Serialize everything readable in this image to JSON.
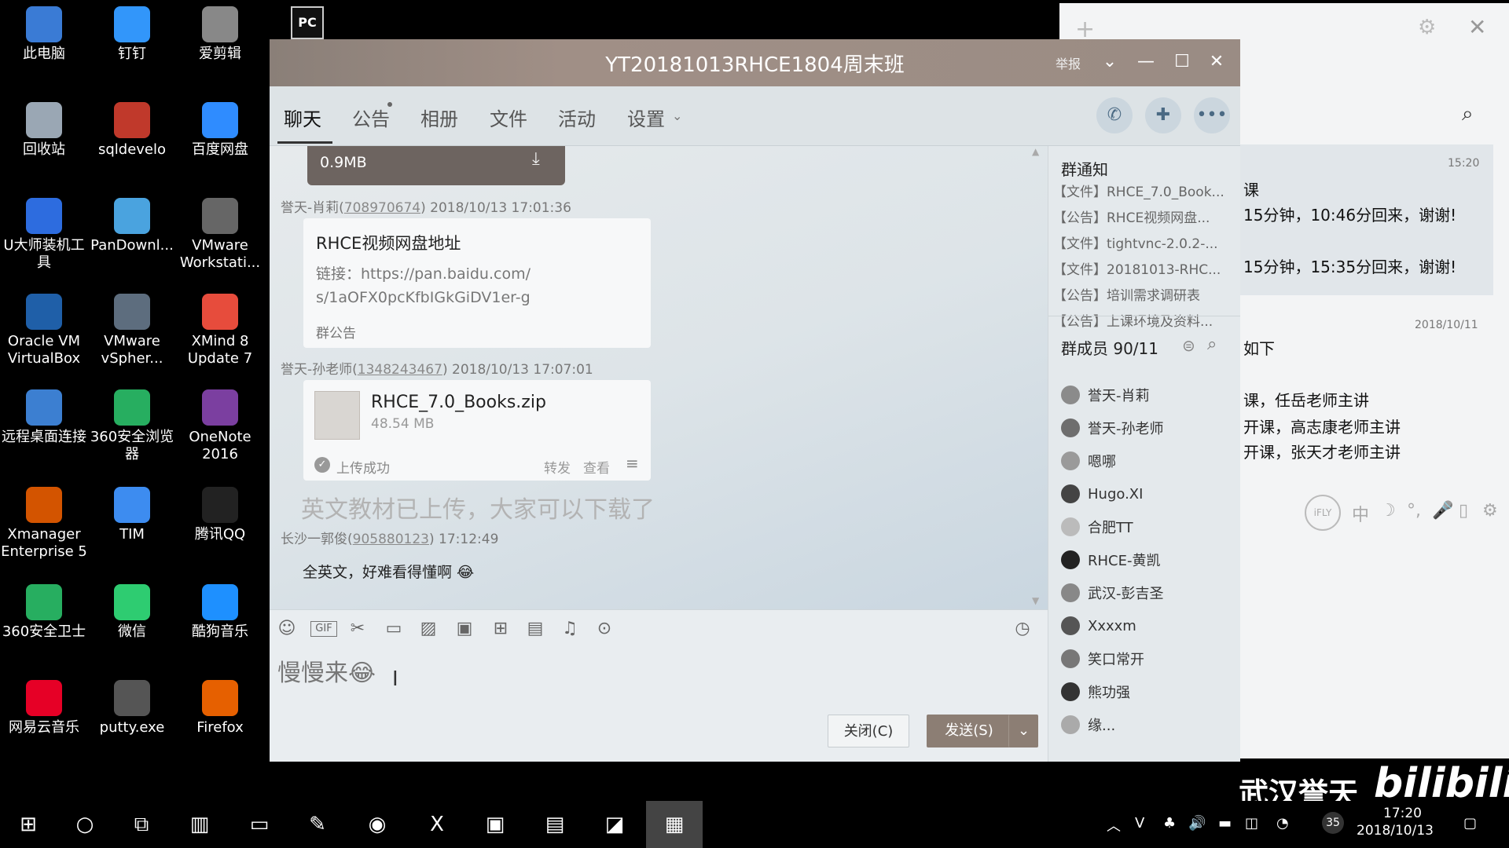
{
  "desktop_icons": [
    {
      "label": "此电脑",
      "icon": "computer-icon",
      "color": "#3a7bd5"
    },
    {
      "label": "钉钉",
      "icon": "dingtalk-icon",
      "color": "#3296fa"
    },
    {
      "label": "爱剪辑",
      "icon": "video-editor-icon",
      "color": "#888888"
    },
    {
      "label": "回收站",
      "icon": "recycle-bin-icon",
      "color": "#9aa7b4"
    },
    {
      "label": "sqldevelo",
      "icon": "sqldeveloper-icon",
      "color": "#c0392b"
    },
    {
      "label": "百度网盘",
      "icon": "baidu-netdisk-icon",
      "color": "#2f8cff"
    },
    {
      "label": "U大师装机工\n具",
      "icon": "usb-tool-icon",
      "color": "#2d6cdf"
    },
    {
      "label": "PanDownl...",
      "icon": "cloud-icon",
      "color": "#4aa3df"
    },
    {
      "label": "VMware\nWorkstati...",
      "icon": "vmware-icon",
      "color": "#666666"
    },
    {
      "label": "Oracle VM\nVirtualBox",
      "icon": "virtualbox-icon",
      "color": "#1f5fa8"
    },
    {
      "label": "VMware\nvSpher...",
      "icon": "vsphere-icon",
      "color": "#5d6d7e"
    },
    {
      "label": "XMind 8\nUpdate 7",
      "icon": "xmind-icon",
      "color": "#e74c3c"
    },
    {
      "label": "远程桌面连接",
      "icon": "remote-desktop-icon",
      "color": "#3c7fd1"
    },
    {
      "label": "360安全浏览\n器",
      "icon": "browser-icon",
      "color": "#27ae60"
    },
    {
      "label": "OneNote\n2016",
      "icon": "onenote-icon",
      "color": "#7b3fa0"
    },
    {
      "label": "Xmanager\nEnterprise 5",
      "icon": "xmanager-icon",
      "color": "#d35400"
    },
    {
      "label": "TIM",
      "icon": "tim-icon",
      "color": "#3d8cf0"
    },
    {
      "label": "腾讯QQ",
      "icon": "qq-penguin-icon",
      "color": "#222222"
    },
    {
      "label": "360安全卫士",
      "icon": "shield-icon",
      "color": "#27ae60"
    },
    {
      "label": "微信",
      "icon": "wechat-icon",
      "color": "#2ecc71"
    },
    {
      "label": "酷狗音乐",
      "icon": "kugou-icon",
      "color": "#1e90ff"
    },
    {
      "label": "网易云音乐",
      "icon": "netease-music-icon",
      "color": "#e60026"
    },
    {
      "label": "putty.exe",
      "icon": "putty-icon",
      "color": "#555555"
    },
    {
      "label": "Firefox",
      "icon": "firefox-icon",
      "color": "#e66000"
    }
  ],
  "qq_window": {
    "title": "YT20181013RHCE1804周末班",
    "report_label": "举报",
    "tabs": [
      "聊天",
      "公告",
      "相册",
      "文件",
      "活动",
      "设置"
    ],
    "file_partial_size": "0.9MB",
    "messages": [
      {
        "sender": "誉天-肖莉",
        "qq": "708970674",
        "time": "2018/10/13 17:01:36",
        "card_title": "RHCE视频网盘地址",
        "card_body": "链接：https://pan.baidu.com/\ns/1aOFX0pcKfbIGkGiDV1er-g",
        "card_footer": "群公告"
      },
      {
        "sender": "誉天-孙老师",
        "qq": "1348243467",
        "time": "2018/10/13 17:07:01",
        "file_name": "RHCE_7.0_Books.zip",
        "file_size": "48.54 MB",
        "status": "上传成功",
        "forward": "转发",
        "view": "查看"
      },
      {
        "text": "英文教材已上传，大家可以下载了"
      },
      {
        "sender": "长沙一郭俊",
        "qq": "905880123",
        "time": "17:12:49",
        "text": "全英文，好难看得懂啊 😂"
      }
    ],
    "input_text": "慢慢来😂",
    "close_button": "关闭(C)",
    "send_button": "发送(S)"
  },
  "right_panel": {
    "notice_header": "群通知",
    "notices": [
      "【文件】RHCE_7.0_Book...",
      "【公告】RHCE视频网盘...",
      "【文件】tightvnc-2.0.2-...",
      "【文件】20181013-RHC...",
      "【公告】培训需求调研表",
      "【公告】上课环境及资料..."
    ],
    "members_header": "群成员 90/11",
    "members": [
      "誉天-肖莉",
      "誉天-孙老师",
      "嗯哪",
      "Hugo.XI",
      "合肥TT",
      "RHCE-黄凯",
      "武汉-彭吉圣",
      "Xxxxm",
      "笑口常开",
      "熊功强",
      "缘..."
    ]
  },
  "side_window": {
    "time1": "15:20",
    "line_a": "课",
    "line_b": "15分钟，10:46分回来，谢谢!",
    "line_c": "15分钟，15:35分回来，谢谢!",
    "date2": "2018/10/11",
    "line_d": "如下",
    "line_e": "课，任岳老师主讲",
    "line_f": "开课，高志康老师主讲",
    "line_g": "开课，张天才老师主讲"
  },
  "ime_bar": [
    "iFLY",
    "中",
    "☽",
    "°,",
    "🎤",
    "▯",
    "⚙"
  ],
  "taskbar": {
    "clock_time": "17:20",
    "clock_date": "2018/10/13",
    "notif_count": "35"
  },
  "watermark": {
    "text1": "武汉誉天",
    "text2": "bilibili"
  }
}
